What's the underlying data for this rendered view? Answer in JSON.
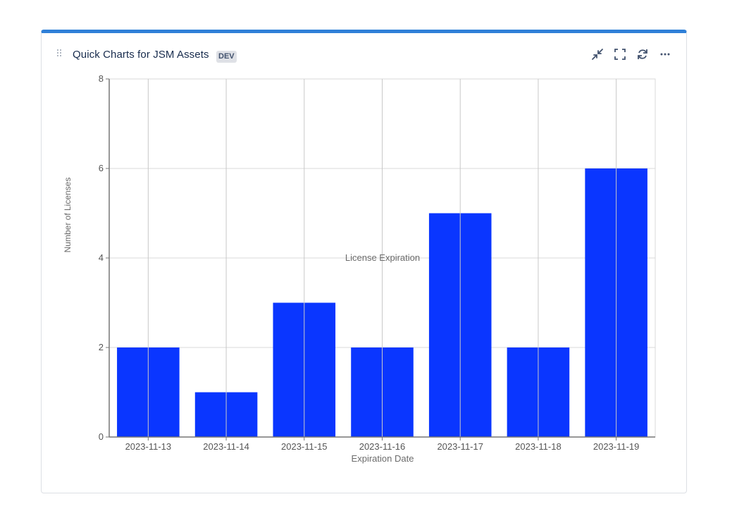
{
  "widget": {
    "title": "Quick Charts for JSM Assets",
    "badge": "DEV",
    "accent_color": "#2f80d8",
    "toolbar": [
      {
        "name": "minimize-icon",
        "label": "Minimize"
      },
      {
        "name": "fullscreen-icon",
        "label": "Fullscreen"
      },
      {
        "name": "refresh-icon",
        "label": "Refresh"
      },
      {
        "name": "more-icon",
        "label": "More"
      }
    ]
  },
  "chart_data": {
    "type": "bar",
    "title": "License Expiration",
    "xlabel": "Expiration Date",
    "ylabel": "Number of Licenses",
    "categories": [
      "2023-11-13",
      "2023-11-14",
      "2023-11-15",
      "2023-11-16",
      "2023-11-17",
      "2023-11-18",
      "2023-11-19"
    ],
    "values": [
      2,
      1,
      3,
      2,
      5,
      2,
      6
    ],
    "ylim": [
      0,
      8
    ],
    "yticks": [
      0,
      2,
      4,
      6,
      8
    ],
    "grid": true,
    "bar_color": "#0a36ff"
  }
}
